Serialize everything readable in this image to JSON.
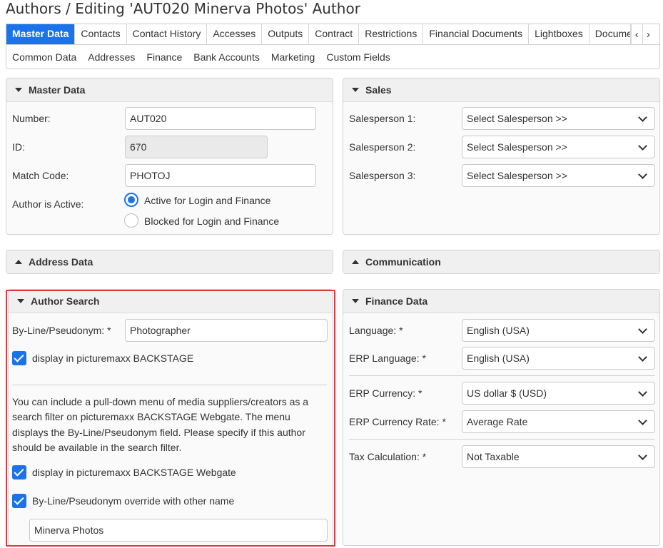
{
  "page": {
    "title": "Authors / Editing 'AUT020 Minerva Photos' Author"
  },
  "tabs": [
    "Master Data",
    "Contacts",
    "Contact History",
    "Accesses",
    "Outputs",
    "Contract",
    "Restrictions",
    "Financial Documents",
    "Lightboxes",
    "Documents"
  ],
  "subtabs": [
    "Common Data",
    "Addresses",
    "Finance",
    "Bank Accounts",
    "Marketing",
    "Custom Fields"
  ],
  "master": {
    "title": "Master Data",
    "number_label": "Number:",
    "number_value": "AUT020",
    "id_label": "ID:",
    "id_value": "670",
    "match_label": "Match Code:",
    "match_value": "PHOTOJ",
    "active_label": "Author is Active:",
    "active_option": "Active for Login and Finance",
    "blocked_option": "Blocked for Login and Finance"
  },
  "sales": {
    "title": "Sales",
    "sp1_label": "Salesperson 1:",
    "sp1_value": "Select Salesperson >>",
    "sp2_label": "Salesperson 2:",
    "sp2_value": "Select Salesperson >>",
    "sp3_label": "Salesperson 3:",
    "sp3_value": "Select Salesperson >>"
  },
  "address": {
    "title": "Address Data"
  },
  "communication": {
    "title": "Communication"
  },
  "author_search": {
    "title": "Author Search",
    "byline_label": "By-Line/Pseudonym:",
    "required": "*",
    "byline_value": "Photographer",
    "display_backstage": "display in picturemaxx BACKSTAGE",
    "info_lines": [
      "You can include a pull-down menu of media suppliers/creators as a",
      "search filter on picturemaxx BACKSTAGE Webgate. The menu",
      "displays the By-Line/Pseudonym field. Please specify if this author",
      "should be available in the search filter."
    ],
    "display_webgate": "display in picturemaxx BACKSTAGE Webgate",
    "override_label": "By-Line/Pseudonym override with other name",
    "override_value": "Minerva Photos"
  },
  "finance": {
    "title": "Finance Data",
    "language_label": "Language:",
    "language_value": "English (USA)",
    "erp_language_label": "ERP Language:",
    "erp_language_value": "English (USA)",
    "currency_label": "ERP Currency:",
    "currency_value": "US dollar $ (USD)",
    "rate_label": "ERP Currency Rate:",
    "rate_value": "Average Rate",
    "tax_label": "Tax Calculation:",
    "tax_value": "Not Taxable",
    "required": "*"
  },
  "colors": {
    "accent": "#1a73e8",
    "highlight": "#e0393e"
  }
}
